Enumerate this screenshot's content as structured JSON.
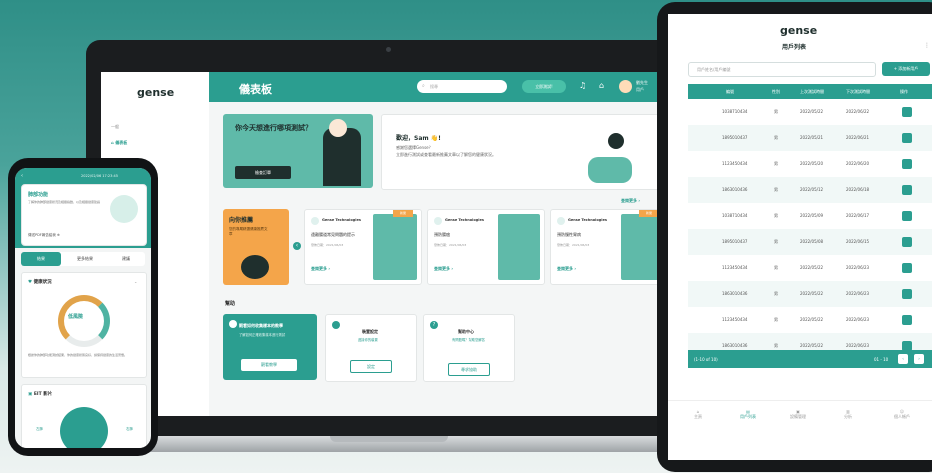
{
  "laptop": {
    "logo": "gense",
    "sidebar": {
      "section": "一般",
      "items": [
        "儀表板"
      ]
    },
    "header": {
      "title": "儀表板",
      "search_placeholder": "搜尋",
      "cta_label": "立即測試!",
      "user_name": "劉先生",
      "user_role": "用戶"
    },
    "hero": {
      "question": "你今天想進行哪項測試？",
      "button_label": "檢查訂單"
    },
    "welcome": {
      "greeting": "歡迎，Sam 👋!",
      "line1": "感謝您選擇Gense？",
      "line2": "立即進行測試或查看最新推薦文章以了解您的健康狀況。"
    },
    "view_more": "查閱更多",
    "recommend": {
      "title": "向你推薦",
      "desc": "您的專屬精選健康推薦文章"
    },
    "articles": [
      {
        "author": "Gense Technologies",
        "title": "遠離腸道常見問題的提示",
        "date": "發佈日期：2021/06/03",
        "tag": "新聞",
        "more": "查閱更多"
      },
      {
        "author": "Gense Technologies",
        "title": "預防腸癌",
        "date": "發佈日期：2021/06/03",
        "tag": "",
        "more": "查閱更多"
      },
      {
        "author": "Gense Technologies",
        "title": "預防慢性胃病",
        "date": "發佈日期：2021/06/03",
        "tag": "新聞",
        "more": "查閱更多"
      }
    ],
    "help": {
      "title": "幫助",
      "cards": [
        {
          "title": "觀看如何收集樣本的教學",
          "desc": "了解如何正確收集樣本進行測試",
          "button": "觀看教學"
        },
        {
          "title": "裝置設定",
          "desc": "連接你的裝置",
          "button": "設定"
        },
        {
          "title": "幫助中心",
          "desc": "有問題嗎？幫助您解答",
          "button": "尋求協助"
        }
      ]
    }
  },
  "tablet": {
    "logo": "gense",
    "title": "用戶列表",
    "search_placeholder": "用戶姓名/用戶編號",
    "add_button": "+ 添加新用戶",
    "columns": [
      "編號",
      "性別",
      "上次測試時間",
      "下次測試時間",
      "操作"
    ],
    "rows": [
      [
        "1038710434",
        "男",
        "2022/05/22",
        "2022/06/22"
      ],
      [
        "1895010437",
        "男",
        "2022/05/21",
        "2022/06/21"
      ],
      [
        "1123450434",
        "男",
        "2022/05/20",
        "2022/06/20"
      ],
      [
        "1863010436",
        "男",
        "2022/05/12",
        "2022/06/18"
      ],
      [
        "1038710434",
        "男",
        "2022/05/09",
        "2022/06/17"
      ],
      [
        "1895010437",
        "男",
        "2022/05/08",
        "2022/06/15"
      ],
      [
        "1123450434",
        "男",
        "2022/05/22",
        "2022/06/23"
      ],
      [
        "1863010436",
        "男",
        "2022/05/22",
        "2022/06/23"
      ],
      [
        "1123450434",
        "男",
        "2022/05/22",
        "2022/06/23"
      ],
      [
        "1863010436",
        "男",
        "2022/05/22",
        "2022/06/23"
      ]
    ],
    "pagination": {
      "summary": "(1-10 of 10)",
      "range": "01 - 10"
    },
    "bottom_nav": [
      "主頁",
      "用戶列表",
      "設備管理",
      "分析",
      "個人帳戶"
    ]
  },
  "phone": {
    "status_time": "2022/02/06 17:23:45",
    "card_title": "肺部功能",
    "card_desc": "了解你的肺部健康狀況及相關指數，以及相關健康建議",
    "download_label": "傳送PDF報告給我",
    "tabs": [
      "結果",
      "更多結果",
      "建議"
    ],
    "health_title": "健康狀況",
    "risk_label": "低風險",
    "risk_desc": "根據你的肺部功能測試結果，你的健康狀態良好，請保持健康的生活習慣。",
    "eit_title": "EIT 影片",
    "lung_left": "左肺",
    "lung_right": "右肺"
  },
  "colors": {
    "primary": "#2b9e90",
    "accent": "#f4a54a",
    "dark": "#1f2f2d"
  }
}
